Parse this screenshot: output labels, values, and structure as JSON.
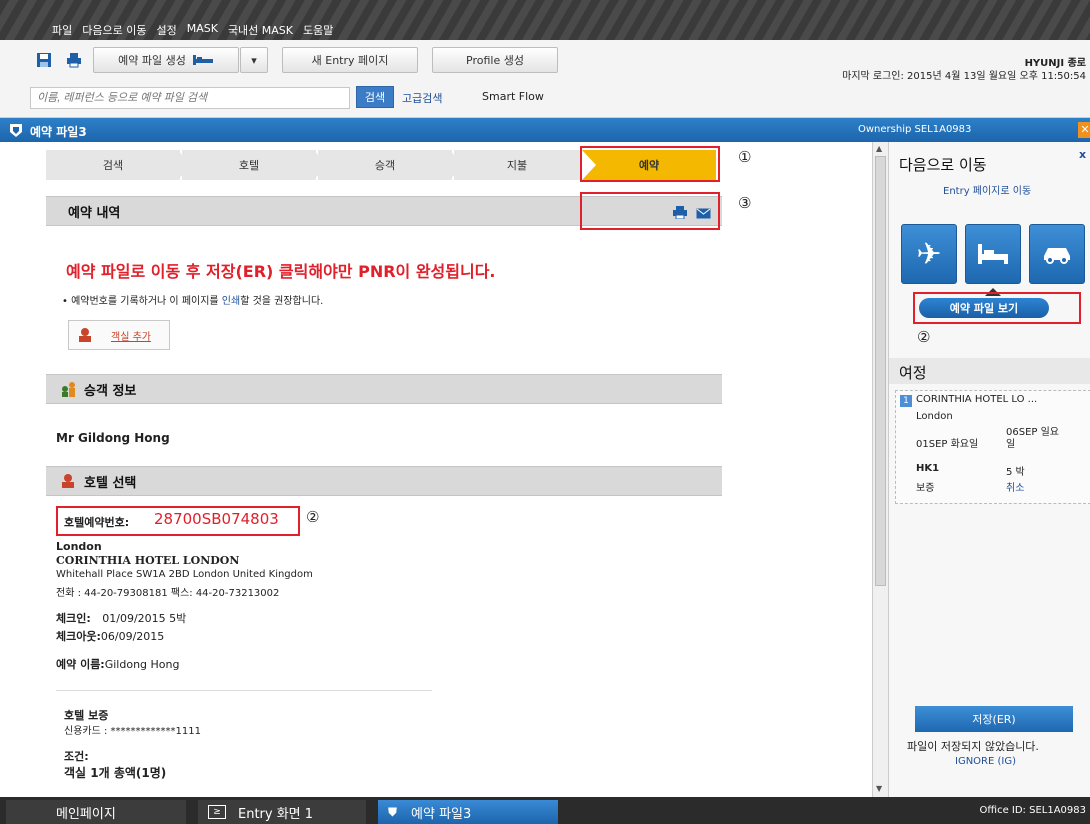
{
  "menubar": {
    "items": [
      "파일",
      "다음으로 이동",
      "설정",
      "MASK",
      "국내선 MASK",
      "도움말"
    ]
  },
  "toolbar": {
    "create_pnr_label": "예약 파일 생성",
    "new_entry_label": "새 Entry 페이지",
    "profile_label": "Profile 생성",
    "user_name": "HYUNJI 종로",
    "last_login": "마지막 로그인: 2015년 4월 13일 월요일 오후 11:50:54",
    "search_placeholder": "이름, 레퍼런스 등으로 예약 파일 검색",
    "search_button": "검색",
    "advanced_search": "고급검색",
    "smart_flow": "Smart Flow"
  },
  "titlebar": {
    "title": "예약 파일3",
    "ownership": "Ownership SEL1A0983"
  },
  "steps": [
    "검색",
    "호텔",
    "승객",
    "지불",
    "예약"
  ],
  "callouts": {
    "one": "①",
    "two": "②",
    "three": "③"
  },
  "booking": {
    "section_title": "예약 내역",
    "notice": "예약 파일로 이동 후 저장(ER) 클릭해야만 PNR이 완성됩니다.",
    "tip_prefix": "• 예약번호를 기록하거나 이 페이지를 ",
    "tip_link": "인쇄",
    "tip_suffix": "할 것을 권장합니다.",
    "add_room": "객실 추가"
  },
  "passenger": {
    "section_title": "승객 정보",
    "name": "Mr Gildong Hong"
  },
  "hotel": {
    "section_title": "호텔 선택",
    "confirmation_label": "호텔예약번호:",
    "confirmation_number": "28700SB074803",
    "city": "London",
    "name": "CORINTHIA HOTEL LONDON",
    "address": "Whitehall Place SW1A 2BD London United Kingdom",
    "phone": "전화 : 44-20-79308181 팩스: 44-20-73213002",
    "checkin_label": "체크인:",
    "checkin_value": "01/09/2015 5박",
    "checkout_label": "체크아웃:",
    "checkout_value": "06/09/2015",
    "booker_label": "예약 이름:",
    "booker_value": "Gildong Hong",
    "guarantee_title": "호텔 보증",
    "card": "신용카드 : *************1111",
    "conditions_title": "조건:",
    "conditions_value": "객실 1개 총액(1명)"
  },
  "right": {
    "goto_title": "다음으로 이동",
    "entry_link": "Entry 페이지로 이동",
    "view_pnr": "예약 파일 보기",
    "itinerary_title": "여정",
    "seg_num": "1",
    "seg_name": "CORINTHIA HOTEL LO ...",
    "seg_city": "London",
    "seg_in": "01SEP 화요일",
    "seg_out": "06SEP 일요일",
    "seg_status": "HK1",
    "seg_nights": "5 박",
    "seg_guarantee": "보증",
    "seg_cancel": "취소",
    "save_button": "저장(ER)",
    "not_saved": "파일이 저장되지 않았습니다.",
    "ignore": "IGNORE (IG)",
    "close_x": "x"
  },
  "bottom": {
    "tab_home": "메인페이지",
    "tab_entry": "Entry 화면 1",
    "tab_pnr": "예약 파일3",
    "office_id": "Office ID: SEL1A0983"
  },
  "colors": {
    "accent_blue": "#1c65ac",
    "active_step": "#f5b800",
    "highlight_red": "#e0202a"
  }
}
